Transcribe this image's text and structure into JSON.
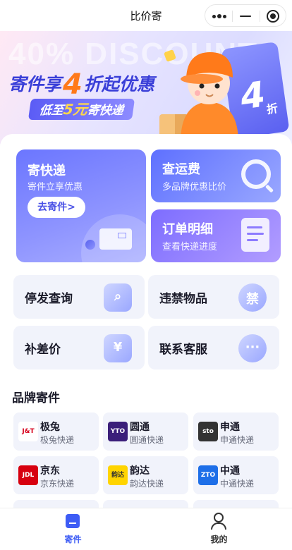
{
  "app": {
    "title": "比价寄"
  },
  "banner": {
    "bg_text": "40% DISCOUNT",
    "headline_pre": "寄件享",
    "headline_num": "4",
    "headline_post": "折起优惠",
    "sub_pre": "低至",
    "sub_num": "5元",
    "sub_post": "寄快递",
    "ticket_num": "4",
    "ticket_unit": "折"
  },
  "cards": {
    "send": {
      "title": "寄快递",
      "subtitle": "寄件立享优惠",
      "button": "去寄件>"
    },
    "fee": {
      "title": "查运费",
      "subtitle": "多品牌优惠比价"
    },
    "order": {
      "title": "订单明细",
      "subtitle": "查看快递进度"
    }
  },
  "tiles": [
    {
      "label": "停发查询",
      "icon": "search-box-icon"
    },
    {
      "label": "违禁物品",
      "icon": "prohibited-icon",
      "glyph": "禁"
    },
    {
      "label": "补差价",
      "icon": "yen-icon",
      "glyph": "¥"
    },
    {
      "label": "联系客服",
      "icon": "chat-bubble-icon",
      "glyph": "···"
    }
  ],
  "brands_section": {
    "title": "品牌寄件"
  },
  "brands": [
    {
      "name": "极兔",
      "sub": "极兔快递",
      "logo": "J&T",
      "color": "#d6001c",
      "bg": "#ffffff"
    },
    {
      "name": "圆通",
      "sub": "圆通快递",
      "logo": "YTO",
      "color": "#ffffff",
      "bg": "#3b1f7a"
    },
    {
      "name": "申通",
      "sub": "申通快递",
      "logo": "sto",
      "color": "#ffffff",
      "bg": "#333333"
    },
    {
      "name": "京东",
      "sub": "京东快递",
      "logo": "JDL",
      "color": "#ffffff",
      "bg": "#d7000f"
    },
    {
      "name": "韵达",
      "sub": "韵达快递",
      "logo": "韵达",
      "color": "#333333",
      "bg": "#ffd400"
    },
    {
      "name": "中通",
      "sub": "中通快递",
      "logo": "ZTO",
      "color": "#ffffff",
      "bg": "#1e6fe8"
    }
  ],
  "bottom_nav": [
    {
      "label": "寄件",
      "active": true
    },
    {
      "label": "我的",
      "active": false
    }
  ],
  "colors": {
    "accent": "#3d5cf5",
    "brand_orange": "#ff7a1a"
  }
}
